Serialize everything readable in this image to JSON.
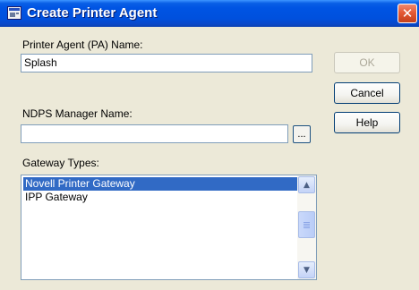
{
  "window": {
    "title": "Create Printer Agent",
    "close_glyph": "✕"
  },
  "form": {
    "pa_name_label": "Printer Agent (PA) Name:",
    "pa_name_value": "Splash",
    "ndps_manager_label": "NDPS Manager Name:",
    "ndps_manager_value": "",
    "browse_label": "...",
    "gateway_types_label": "Gateway Types:"
  },
  "gateway_types": {
    "items": [
      "Novell Printer Gateway",
      "IPP Gateway"
    ],
    "selected": "Novell Printer Gateway"
  },
  "buttons": {
    "ok": "OK",
    "cancel": "Cancel",
    "help": "Help"
  },
  "icons": {
    "window_icon": "printer-agent-icon",
    "scroll_up": "arrow-up-icon",
    "scroll_down": "arrow-down-icon"
  },
  "colors": {
    "titlebar": "#0054e3",
    "selection": "#316ac5",
    "dialog_bg": "#ece9d8"
  }
}
